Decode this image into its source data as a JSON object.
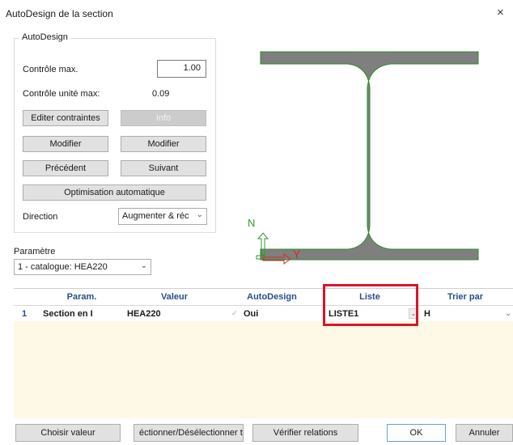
{
  "window": {
    "title": "AutoDesign de la section",
    "close_glyph": "×"
  },
  "autodesign_group": {
    "legend": "AutoDesign",
    "controle_max_label": "Contrôle max.",
    "controle_max_value": "1.00",
    "controle_unite_label": "Contrôle unité max:",
    "controle_unite_value": "0.09",
    "editer_contraintes": "Editer contraintes",
    "info": "Info",
    "modifier_left": "Modifier",
    "modifier_right": "Modifier",
    "precedent": "Précédent",
    "suivant": "Suivant",
    "optimisation": "Optimisation automatique",
    "direction_label": "Direction",
    "direction_value": "Augmenter & réc"
  },
  "parametre": {
    "label": "Paramètre",
    "selected": "1 - catalogue: HEA220"
  },
  "preview": {
    "axis_n": "N",
    "axis_y": "Y",
    "colors": {
      "section": "#7f7f7f",
      "outline": "#2d8a2d",
      "n_axis": "#2e9b2e",
      "y_axis": "#e0271f"
    }
  },
  "grid": {
    "headers": [
      "Param.",
      "Valeur",
      "AutoDesign",
      "Liste",
      "Trier par"
    ],
    "rows": [
      {
        "index": "1",
        "param": "Section en I",
        "valeur": "HEA220",
        "autodesign": "Oui",
        "liste": "LISTE1",
        "trier_par": "H"
      }
    ]
  },
  "footer": {
    "choisir_valeur": "Choisir valeur",
    "selectionner": "éctionner/Désélectionner t",
    "verifier_relations": "Vérifier relations",
    "ok": "OK",
    "annuler": "Annuler"
  },
  "colors": {
    "highlight": "#d9152a",
    "header_text": "#2b4d8c",
    "grid_bg": "#fdf9e6"
  }
}
